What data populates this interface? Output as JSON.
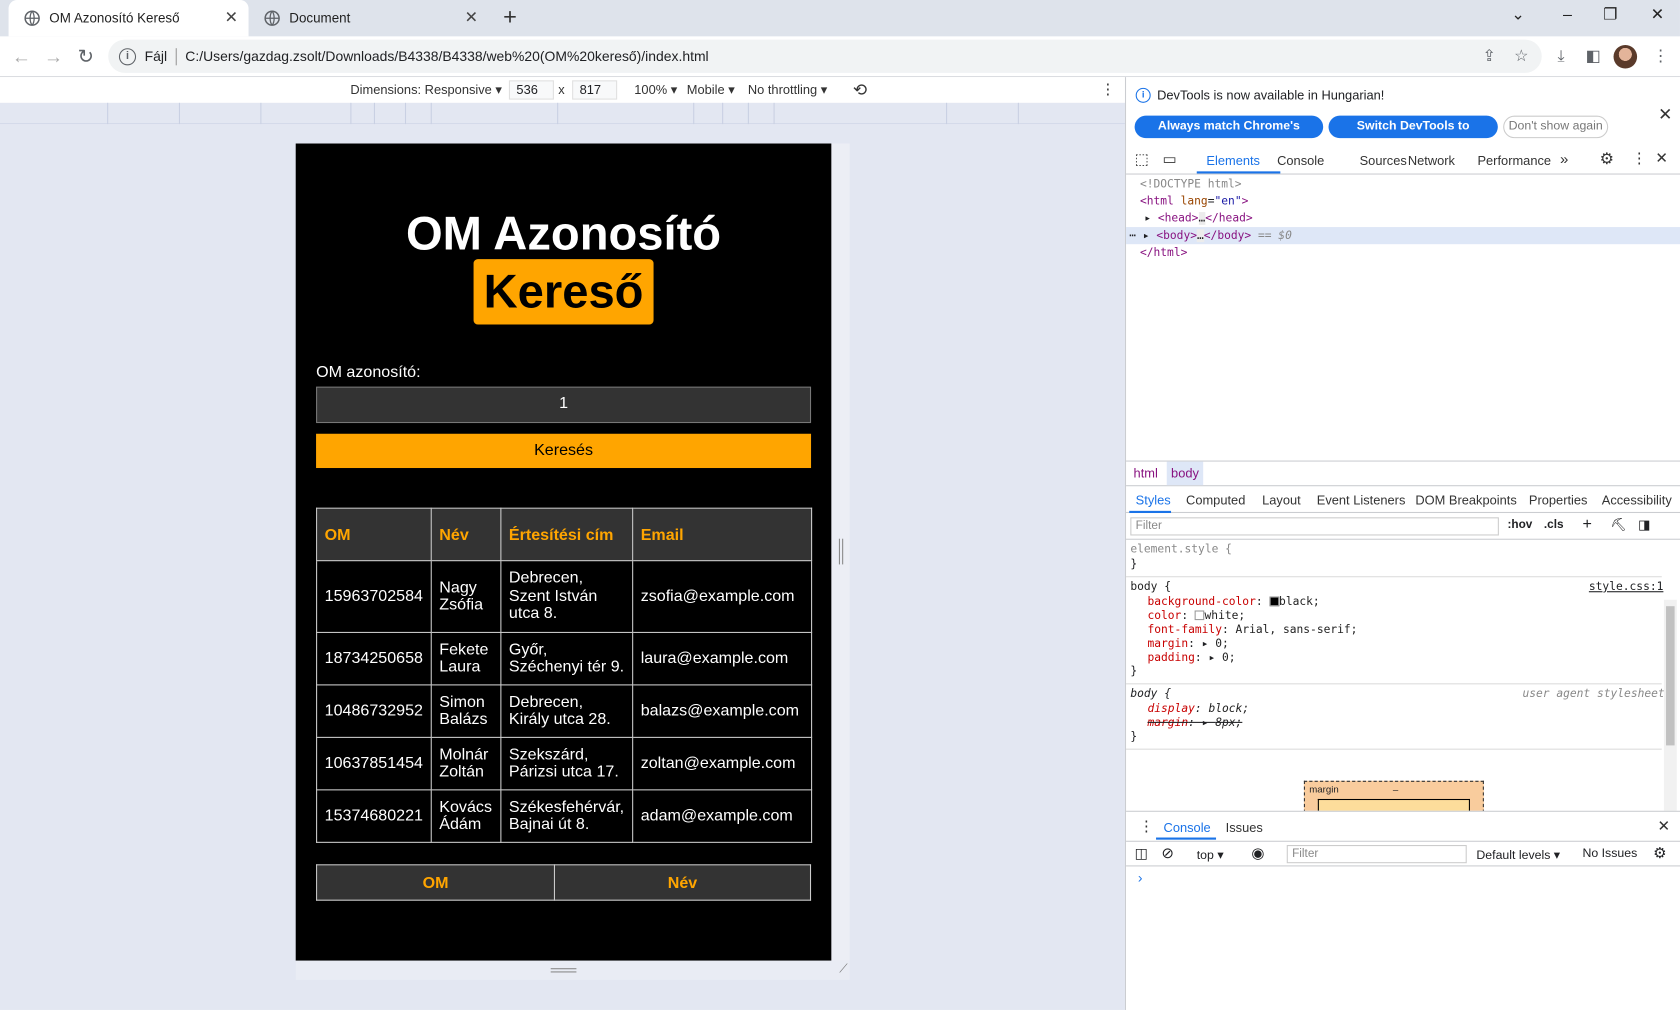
{
  "browser": {
    "tabs": [
      {
        "title": "OM Azonosító Kereső",
        "active": true
      },
      {
        "title": "Document",
        "active": false
      }
    ],
    "scheme_label": "Fájl",
    "url": "C:/Users/gazdag.zsolt/Downloads/B4338/B4338/web%20(OM%20kereső)/index.html"
  },
  "device_toolbar": {
    "dimensions": "Dimensions: Responsive",
    "width": "536",
    "height": "817",
    "times": "x",
    "zoom": "100%",
    "device_type": "Mobile",
    "throttling": "No throttling"
  },
  "page": {
    "title_line1": "OM Azonosító",
    "title_line2": "Kereső",
    "input_label": "OM azonosító:",
    "input_value": "1",
    "search_button": "Keresés",
    "table_headers": [
      "OM",
      "Név",
      "Értesítési cím",
      "Email"
    ],
    "rows": [
      {
        "om": "15963702584",
        "nev": "Nagy Zsófia",
        "cim": "Debrecen, Szent István utca 8.",
        "email": "zsofia@example.com"
      },
      {
        "om": "18734250658",
        "nev": "Fekete Laura",
        "cim": "Győr, Széchenyi tér 9.",
        "email": "laura@example.com"
      },
      {
        "om": "10486732952",
        "nev": "Simon Balázs",
        "cim": "Debrecen, Király utca 28.",
        "email": "balazs@example.com"
      },
      {
        "om": "10637851454",
        "nev": "Molnár Zoltán",
        "cim": "Szekszárd, Párizsi utca 17.",
        "email": "zoltan@example.com"
      },
      {
        "om": "15374680221",
        "nev": "Kovács Ádám",
        "cim": "Székesfehérvár, Bajnai út 8.",
        "email": "adam@example.com"
      }
    ],
    "sort_buttons": [
      "OM",
      "Név"
    ],
    "colors": {
      "accent": "#ffa500",
      "background": "#000000",
      "cell_dark": "#333333"
    }
  },
  "devtools": {
    "banner": "DevTools is now available in Hungarian!",
    "btn_match": "Always match Chrome's language",
    "btn_switch": "Switch DevTools to Hungarian",
    "btn_dismiss": "Don't show again",
    "tabs": [
      "Elements",
      "Console",
      "Sources",
      "Network",
      "Performance"
    ],
    "dom": {
      "doctype": "<!DOCTYPE html>",
      "html_open": "<html",
      "lang_attr": "lang",
      "lang_val": "\"en\"",
      "head": "<head>",
      "head_close": "</head>",
      "body": "<body>",
      "body_close": "</body>",
      "body_suffix": "== $0",
      "html_close": "</html>",
      "ellipsis": "…"
    },
    "breadcrumbs": [
      "html",
      "body"
    ],
    "style_tabs": [
      "Styles",
      "Computed",
      "Layout",
      "Event Listeners",
      "DOM Breakpoints",
      "Properties",
      "Accessibility"
    ],
    "filter_placeholder": "Filter",
    "hov": ":hov",
    "cls": ".cls",
    "styles": {
      "element_style": "element.style {",
      "close": "}",
      "body_sel": "body {",
      "source": "style.css:1",
      "props": [
        {
          "name": "background-color",
          "value": "black;"
        },
        {
          "name": "color",
          "value": "white;"
        },
        {
          "name": "font-family",
          "value": "Arial, sans-serif;"
        },
        {
          "name": "margin",
          "value": "0;"
        },
        {
          "name": "padding",
          "value": "0;"
        }
      ],
      "ua_label": "user agent stylesheet",
      "ua_display_name": "display",
      "ua_display_val": "block;",
      "ua_margin_name": "margin",
      "ua_margin_val": "8px;",
      "box_label": "margin",
      "box_dash": "–"
    },
    "drawer_tabs": [
      "Console",
      "Issues"
    ],
    "console": {
      "context": "top",
      "filter_placeholder": "Filter",
      "levels": "Default levels",
      "issues": "No Issues"
    }
  }
}
